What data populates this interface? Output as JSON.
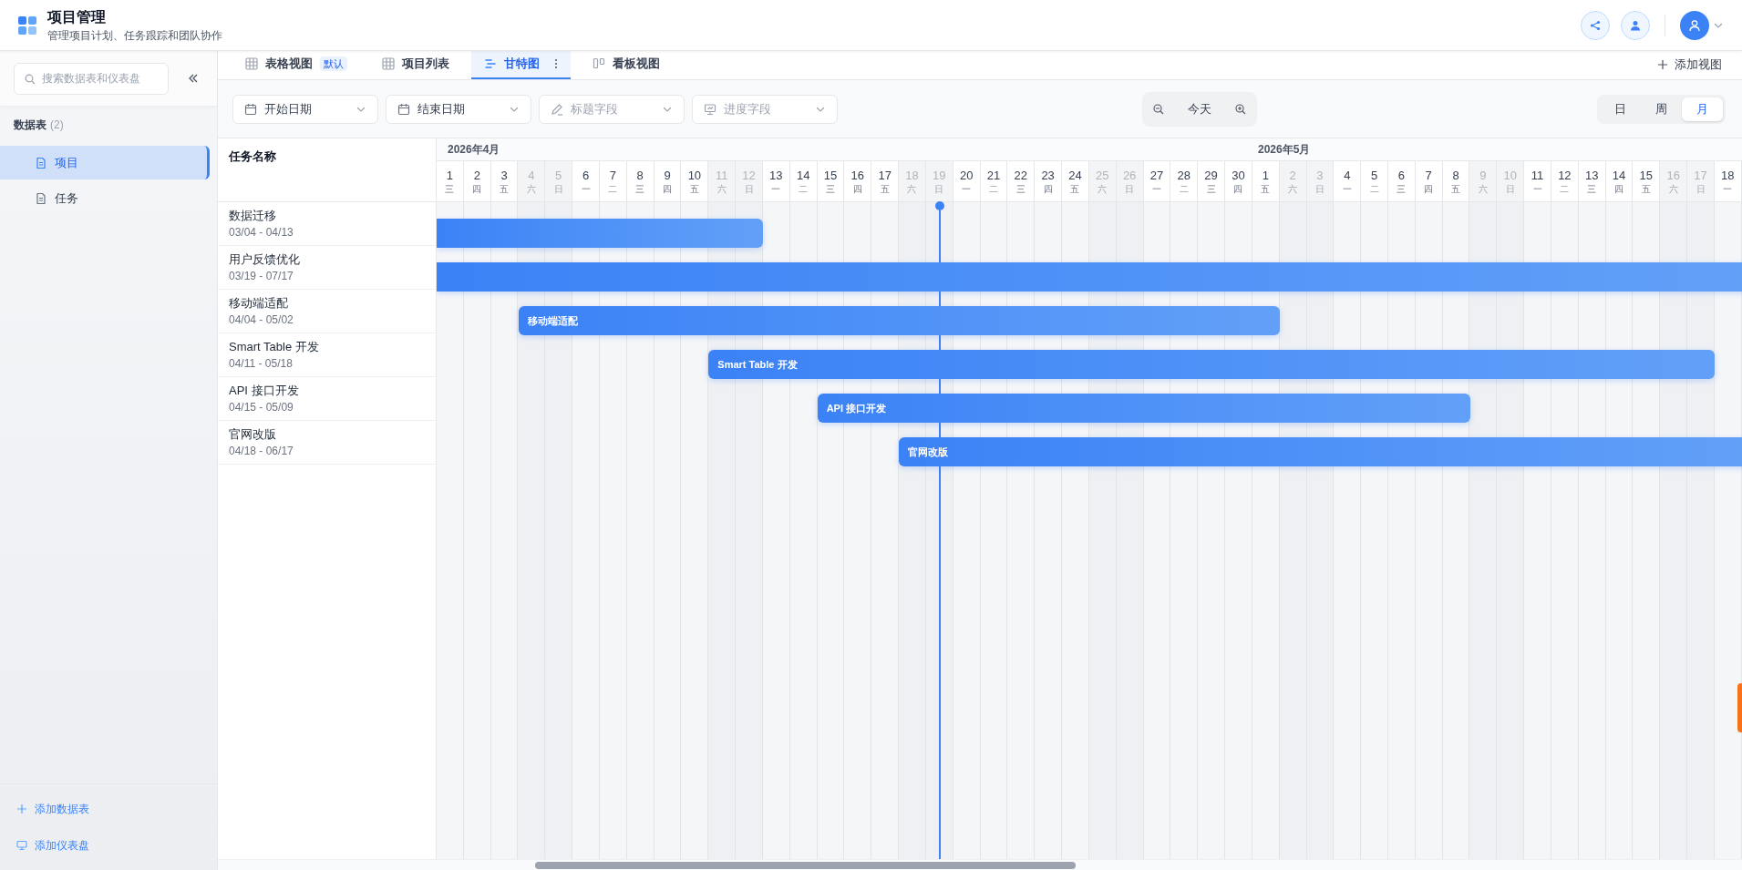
{
  "app": {
    "title": "项目管理",
    "subtitle": "管理项目计划、任务跟踪和团队协作"
  },
  "sidebar": {
    "search_placeholder": "搜索数据表和仪表盘",
    "section_title": "数据表",
    "section_count": "(2)",
    "items": [
      {
        "label": "项目",
        "selected": true
      },
      {
        "label": "任务",
        "selected": false
      }
    ],
    "footer_actions": [
      "添加数据表",
      "添加仪表盘"
    ]
  },
  "tabs": [
    {
      "label": "表格视图",
      "kind": "table",
      "badge": "默认",
      "selected": false
    },
    {
      "label": "项目列表",
      "kind": "table",
      "selected": false
    },
    {
      "label": "甘特图",
      "kind": "gantt",
      "selected": true
    },
    {
      "label": "看板视图",
      "kind": "board",
      "selected": false
    }
  ],
  "add_view": "添加视图",
  "toolbar": {
    "fields": [
      {
        "kind": "calendar",
        "value": "开始日期"
      },
      {
        "kind": "calendar",
        "value": "结束日期"
      },
      {
        "kind": "pen",
        "placeholder": "标题字段"
      },
      {
        "kind": "chart",
        "placeholder": "进度字段"
      }
    ],
    "today_button": "今天",
    "scales": [
      {
        "label": "日",
        "selected": false
      },
      {
        "label": "周",
        "selected": false
      },
      {
        "label": "月",
        "selected": true
      }
    ]
  },
  "gantt": {
    "name_column": "任务名称",
    "months": [
      {
        "label": "2026年4月",
        "days": [
          {
            "day": "1",
            "weekday": "三",
            "weekend": false
          },
          {
            "day": "2",
            "weekday": "四",
            "weekend": false
          },
          {
            "day": "3",
            "weekday": "五",
            "weekend": false
          },
          {
            "day": "4",
            "weekday": "六",
            "weekend": true
          },
          {
            "day": "5",
            "weekday": "日",
            "weekend": true
          },
          {
            "day": "6",
            "weekday": "一",
            "weekend": false
          },
          {
            "day": "7",
            "weekday": "二",
            "weekend": false
          },
          {
            "day": "8",
            "weekday": "三",
            "weekend": false
          },
          {
            "day": "9",
            "weekday": "四",
            "weekend": false
          },
          {
            "day": "10",
            "weekday": "五",
            "weekend": false
          },
          {
            "day": "11",
            "weekday": "六",
            "weekend": true
          },
          {
            "day": "12",
            "weekday": "日",
            "weekend": true
          },
          {
            "day": "13",
            "weekday": "一",
            "weekend": false
          },
          {
            "day": "14",
            "weekday": "二",
            "weekend": false
          },
          {
            "day": "15",
            "weekday": "三",
            "weekend": false
          },
          {
            "day": "16",
            "weekday": "四",
            "weekend": false
          },
          {
            "day": "17",
            "weekday": "五",
            "weekend": false
          },
          {
            "day": "18",
            "weekday": "六",
            "weekend": true
          },
          {
            "day": "19",
            "weekday": "日",
            "weekend": true,
            "today": true
          },
          {
            "day": "20",
            "weekday": "一",
            "weekend": false
          },
          {
            "day": "21",
            "weekday": "二",
            "weekend": false
          },
          {
            "day": "22",
            "weekday": "三",
            "weekend": false
          },
          {
            "day": "23",
            "weekday": "四",
            "weekend": false
          },
          {
            "day": "24",
            "weekday": "五",
            "weekend": false
          },
          {
            "day": "25",
            "weekday": "六",
            "weekend": true
          },
          {
            "day": "26",
            "weekday": "日",
            "weekend": true
          },
          {
            "day": "27",
            "weekday": "一",
            "weekend": false
          },
          {
            "day": "28",
            "weekday": "二",
            "weekend": false
          },
          {
            "day": "29",
            "weekday": "三",
            "weekend": false
          },
          {
            "day": "30",
            "weekday": "四",
            "weekend": false
          }
        ]
      },
      {
        "label": "2026年5月",
        "days": [
          {
            "day": "1",
            "weekday": "五",
            "weekend": false
          },
          {
            "day": "2",
            "weekday": "六",
            "weekend": true
          },
          {
            "day": "3",
            "weekday": "日",
            "weekend": true
          },
          {
            "day": "4",
            "weekday": "一",
            "weekend": false
          },
          {
            "day": "5",
            "weekday": "二",
            "weekend": false
          },
          {
            "day": "6",
            "weekday": "三",
            "weekend": false
          },
          {
            "day": "7",
            "weekday": "四",
            "weekend": false
          },
          {
            "day": "8",
            "weekday": "五",
            "weekend": false
          },
          {
            "day": "9",
            "weekday": "六",
            "weekend": true
          },
          {
            "day": "10",
            "weekday": "日",
            "weekend": true
          },
          {
            "day": "11",
            "weekday": "一",
            "weekend": false
          },
          {
            "day": "12",
            "weekday": "二",
            "weekend": false
          },
          {
            "day": "13",
            "weekday": "三",
            "weekend": false
          },
          {
            "day": "14",
            "weekday": "四",
            "weekend": false
          },
          {
            "day": "15",
            "weekday": "五",
            "weekend": false
          },
          {
            "day": "16",
            "weekday": "六",
            "weekend": true
          },
          {
            "day": "17",
            "weekday": "日",
            "weekend": true
          },
          {
            "day": "18",
            "weekday": "一",
            "weekend": false
          }
        ]
      }
    ],
    "tasks": [
      {
        "name": "数据迁移",
        "dates": "03/04 - 04/13"
      },
      {
        "name": "用户反馈优化",
        "dates": "03/19 - 07/17"
      },
      {
        "name": "移动端适配",
        "dates": "04/04 - 05/02",
        "bar_label": "移动端适配"
      },
      {
        "name": "Smart Table 开发",
        "dates": "04/11 - 05/18",
        "bar_label": "Smart Table 开发"
      },
      {
        "name": "API 接口开发",
        "dates": "04/15 - 05/09",
        "bar_label": "API 接口开发"
      },
      {
        "name": "官网改版",
        "dates": "04/18 - 06/17",
        "bar_label": "官网改版"
      }
    ]
  }
}
